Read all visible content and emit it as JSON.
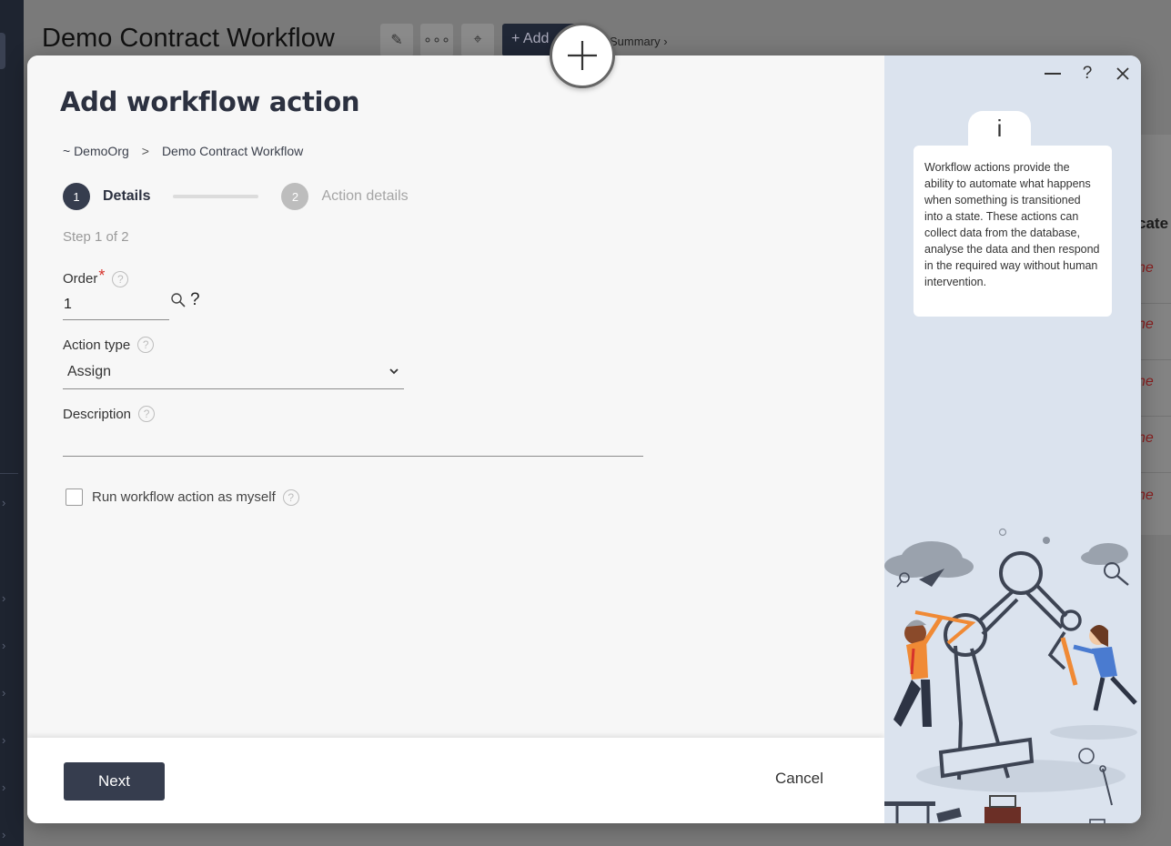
{
  "background": {
    "page_title": "Demo Contract Workflow",
    "add_button_label": "Add",
    "summary_link": "Summary ›",
    "column_header_partial": "cate",
    "row_values_partial": [
      "ne",
      "ne",
      "ne",
      "ne",
      "ne"
    ]
  },
  "modal": {
    "title": "Add workflow action",
    "breadcrumb": [
      "~ DemoOrg",
      "Demo Contract Workflow"
    ],
    "breadcrumb_separator": ">",
    "steps": [
      {
        "number": "1",
        "label": "Details",
        "state": "active"
      },
      {
        "number": "2",
        "label": "Action details",
        "state": "inactive"
      }
    ],
    "step_counter": "Step 1 of 2",
    "fields": {
      "order": {
        "label": "Order",
        "required_mark": "*",
        "value": "1",
        "help": "?",
        "lookup_help": "?"
      },
      "action_type": {
        "label": "Action type",
        "value": "Assign",
        "help": "?"
      },
      "description": {
        "label": "Description",
        "value": "",
        "help": "?"
      },
      "run_as_myself": {
        "label": "Run workflow action as myself",
        "checked": false,
        "help": "?"
      }
    },
    "footer": {
      "next_label": "Next",
      "cancel_label": "Cancel"
    },
    "window_controls": {
      "minimize": "—",
      "help": "?",
      "close": "✕"
    },
    "info": {
      "icon_glyph": "i",
      "text": "Workflow actions provide the ability to automate what happens when something is transitioned into a state. These actions can collect data from the database, analyse the data and then respond in the required way without human intervention."
    }
  },
  "colors": {
    "primary": "#363d4e",
    "side_panel": "#dbe3ee",
    "required": "#d6332c",
    "illustration_orange": "#f08a35",
    "illustration_blue": "#4a7bd0"
  }
}
